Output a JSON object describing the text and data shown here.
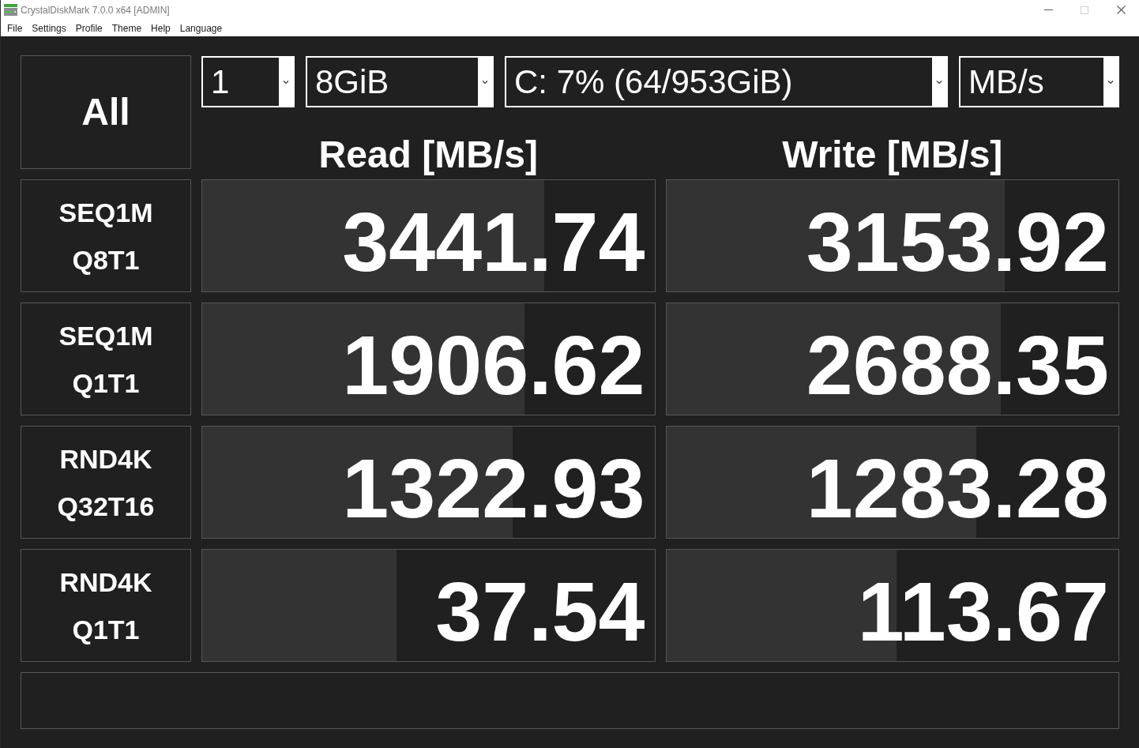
{
  "window": {
    "title": "CrystalDiskMark 7.0.0 x64 [ADMIN]",
    "controls": [
      {
        "kind": "minimize",
        "disabled": false
      },
      {
        "kind": "maximize",
        "disabled": true
      },
      {
        "kind": "close",
        "disabled": false
      }
    ]
  },
  "menu": [
    "File",
    "Settings",
    "Profile",
    "Theme",
    "Help",
    "Language"
  ],
  "all_button": {
    "label": "All"
  },
  "selectors": [
    {
      "value": "1"
    },
    {
      "value": "8GiB"
    },
    {
      "value": "C: 7% (64/953GiB)"
    },
    {
      "value": "MB/s"
    }
  ],
  "columns": [
    "Read [MB/s]",
    "Write [MB/s]"
  ],
  "tests": [
    {
      "label": "SEQ1M",
      "params": "Q8T1",
      "read": {
        "value": "3441.74",
        "level": 0.756
      },
      "write": {
        "value": "3153.92",
        "level": 0.749
      }
    },
    {
      "label": "SEQ1M",
      "params": "Q1T1",
      "read": {
        "value": "1906.62",
        "level": 0.713
      },
      "write": {
        "value": "2688.35",
        "level": 0.739
      }
    },
    {
      "label": "RND4K",
      "params": "Q32T16",
      "read": {
        "value": "1322.93",
        "level": 0.686
      },
      "write": {
        "value": "1283.28",
        "level": 0.685
      }
    },
    {
      "label": "RND4K",
      "params": "Q1T1",
      "read": {
        "value": "37.54",
        "level": 0.429
      },
      "write": {
        "value": "113.67",
        "level": 0.509
      }
    }
  ]
}
